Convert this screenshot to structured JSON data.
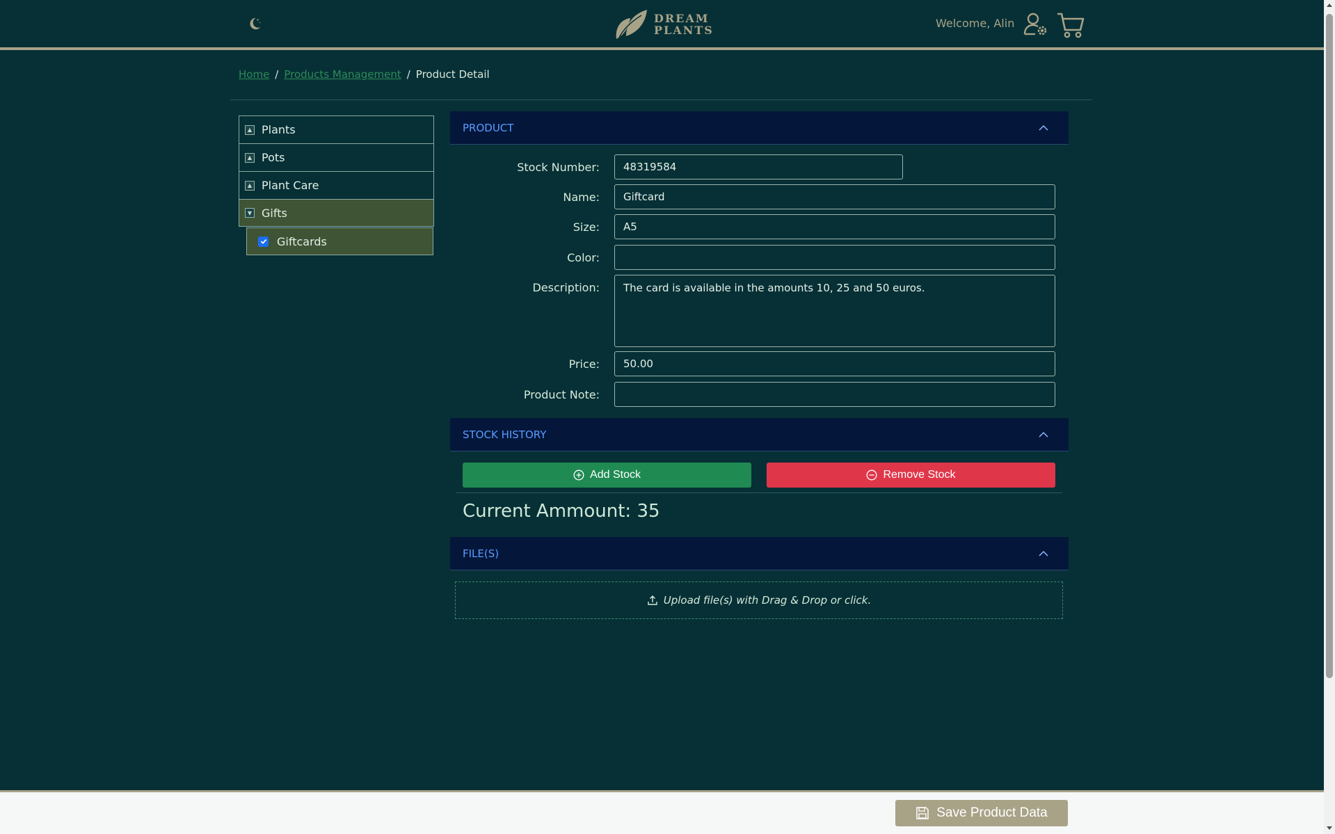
{
  "header": {
    "logo_line1": "DREAM",
    "logo_line2": "PLANTS",
    "welcome": "Welcome, Alin",
    "theme_icon": "moon-icon",
    "account_icon": "user-settings-icon",
    "cart_icon": "cart-icon"
  },
  "breadcrumb": {
    "items": [
      "Home",
      "Products Management",
      "Product Detail"
    ],
    "separator": "/"
  },
  "sidebar": {
    "categories": [
      {
        "label": "Plants",
        "expanded": false
      },
      {
        "label": "Pots",
        "expanded": false
      },
      {
        "label": "Plant Care",
        "expanded": false
      },
      {
        "label": "Gifts",
        "expanded": true
      }
    ],
    "subcategories": [
      {
        "label": "Giftcards",
        "checked": true
      }
    ]
  },
  "product_section": {
    "title": "PRODUCT",
    "fields": {
      "stock_number": {
        "label": "Stock Number:",
        "value": "48319584"
      },
      "name": {
        "label": "Name:",
        "value": "Giftcard"
      },
      "size": {
        "label": "Size:",
        "value": "A5"
      },
      "color": {
        "label": "Color:",
        "value": ""
      },
      "description": {
        "label": "Description:",
        "value": "The card is available in the amounts 10, 25 and 50 euros."
      },
      "price": {
        "label": "Price:",
        "value": "50.00"
      },
      "product_note": {
        "label": "Product Note:",
        "value": ""
      }
    }
  },
  "stock_section": {
    "title": "STOCK HISTORY",
    "add_label": "Add Stock",
    "remove_label": "Remove Stock",
    "current_label": "Current Ammount:",
    "current_value": "35"
  },
  "files_section": {
    "title": "FILE(S)",
    "upload_text": "Upload file(s) with Drag & Drop or click."
  },
  "footer": {
    "save_label": "Save Product Data"
  },
  "colors": {
    "background": "#063036",
    "accent": "#a8a287",
    "section_header": "#04173a",
    "section_title": "#5c9bff",
    "add_button": "#1f8a52",
    "remove_button": "#e0364a",
    "active_category": "#3f5435"
  }
}
